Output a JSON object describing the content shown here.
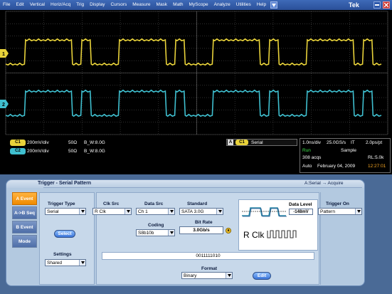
{
  "menubar": {
    "items": [
      "File",
      "Edit",
      "Vertical",
      "Horiz/Acq",
      "Trig",
      "Display",
      "Cursors",
      "Measure",
      "Mask",
      "Math",
      "MyScope",
      "Analyze",
      "Utilities",
      "Help"
    ],
    "brand": "Tek",
    "dropdown_icon": "triangle-down-icon",
    "minimize_icon": "minus-icon",
    "close_icon": "close-x-icon"
  },
  "graticule": {
    "ch1_marker": "1",
    "ch2_marker": "2",
    "ch1_color": "#e8d23a",
    "ch2_color": "#3fbfcf",
    "ch1_pattern": "0011111010",
    "ch2_pattern": "0011111010"
  },
  "readouts": {
    "ch1": {
      "badge": "C1",
      "scale": "200mV/div",
      "impedance": "50Ω",
      "bandwidth": "B_W:8.0G"
    },
    "ch2": {
      "badge": "C2",
      "scale": "200mV/div",
      "impedance": "50Ω",
      "bandwidth": "B_W:8.0G"
    },
    "trigger_source": {
      "badge_a": "A",
      "badge_ch": "C1",
      "label": "Serial"
    },
    "acquisition": {
      "horiz": "1.0ns/div",
      "sample_rate": "25.0GS/s",
      "mode": "IT",
      "ps_per_pt": "2.0ps/pt",
      "state": "Run",
      "acq_mode": "Sample",
      "acqs": "308 acqs",
      "record_length": "RL:5.0k",
      "trigger_mode": "Auto",
      "date": "February 04, 2009",
      "time": "12:27:01"
    }
  },
  "trigger_panel": {
    "title": "Trigger - Serial Pattern",
    "status": "A:Serial → Acquire",
    "tabs": [
      "A Event",
      "A->B Seq",
      "B Event",
      "Mode"
    ],
    "trigger_type": {
      "label": "Trigger Type",
      "value": "Serial"
    },
    "select_button": "Select",
    "settings": {
      "label": "Settings",
      "value": "Shared"
    },
    "clk_src": {
      "label": "Clk Src",
      "value": "R Clk"
    },
    "data_src": {
      "label": "Data Src",
      "value": "Ch 1"
    },
    "standard": {
      "label": "Standard",
      "value": "SATA 3.0G"
    },
    "coding": {
      "label": "Coding",
      "value": "S8b10b"
    },
    "bit_rate": {
      "label": "Bit Rate",
      "value": "3.0Gb/s"
    },
    "bit_rate_icon": "a",
    "data_level": {
      "label": "Data Level",
      "value": "-148mV"
    },
    "clock_label": "R Clk",
    "pattern": "0011111010",
    "format": {
      "label": "Format",
      "value": "Binary"
    },
    "edit_button": "Edit",
    "trigger_on": {
      "label": "Trigger On",
      "value": "Pattern"
    },
    "colors": {
      "accent": "#f08a00",
      "panel": "#b3c9e0",
      "button": "#3a74d8"
    }
  }
}
